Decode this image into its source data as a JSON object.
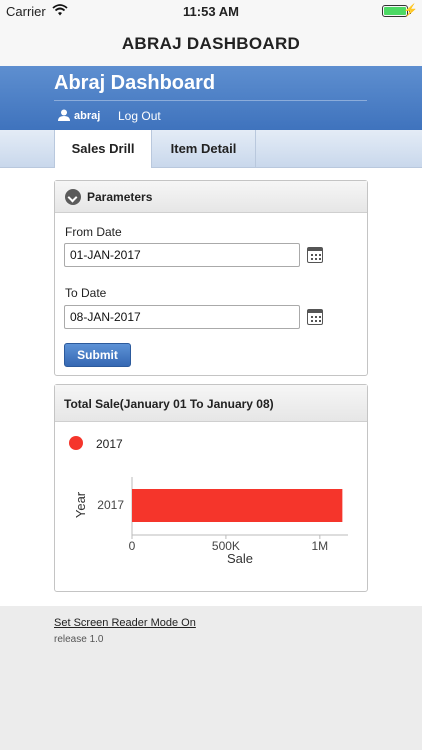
{
  "status_bar": {
    "carrier": "Carrier",
    "time": "11:53 AM",
    "battery_level": 1.0
  },
  "nav": {
    "title": "ABRAJ DASHBOARD"
  },
  "header": {
    "title": "Abraj Dashboard",
    "user": "abraj",
    "logout": "Log Out"
  },
  "tabs": [
    {
      "label": "Sales Drill",
      "active": true
    },
    {
      "label": "Item Detail",
      "active": false
    }
  ],
  "parameters": {
    "title": "Parameters",
    "from_label": "From Date",
    "from_value": "01-JAN-2017",
    "to_label": "To Date",
    "to_value": "08-JAN-2017",
    "submit_label": "Submit"
  },
  "chart_panel": {
    "title": "Total Sale(January 01 To January 08)"
  },
  "chart_data": {
    "type": "bar",
    "orientation": "horizontal",
    "categories": [
      "2017"
    ],
    "series": [
      {
        "name": "2017",
        "values": [
          1120000
        ],
        "color": "#f5352b"
      }
    ],
    "xlabel": "Sale",
    "ylabel": "Year",
    "xlim": [
      0,
      1150000
    ],
    "xticks": [
      {
        "value": 0,
        "label": "0"
      },
      {
        "value": 500000,
        "label": "500K"
      },
      {
        "value": 1000000,
        "label": "1M"
      }
    ],
    "legend": "top-left",
    "grid": false
  },
  "footer": {
    "screen_reader": "Set Screen Reader Mode On",
    "release": "release 1.0"
  },
  "colors": {
    "header_blue": "#3f73bd",
    "button_blue": "#3568b3",
    "bar_red": "#f5352b"
  }
}
